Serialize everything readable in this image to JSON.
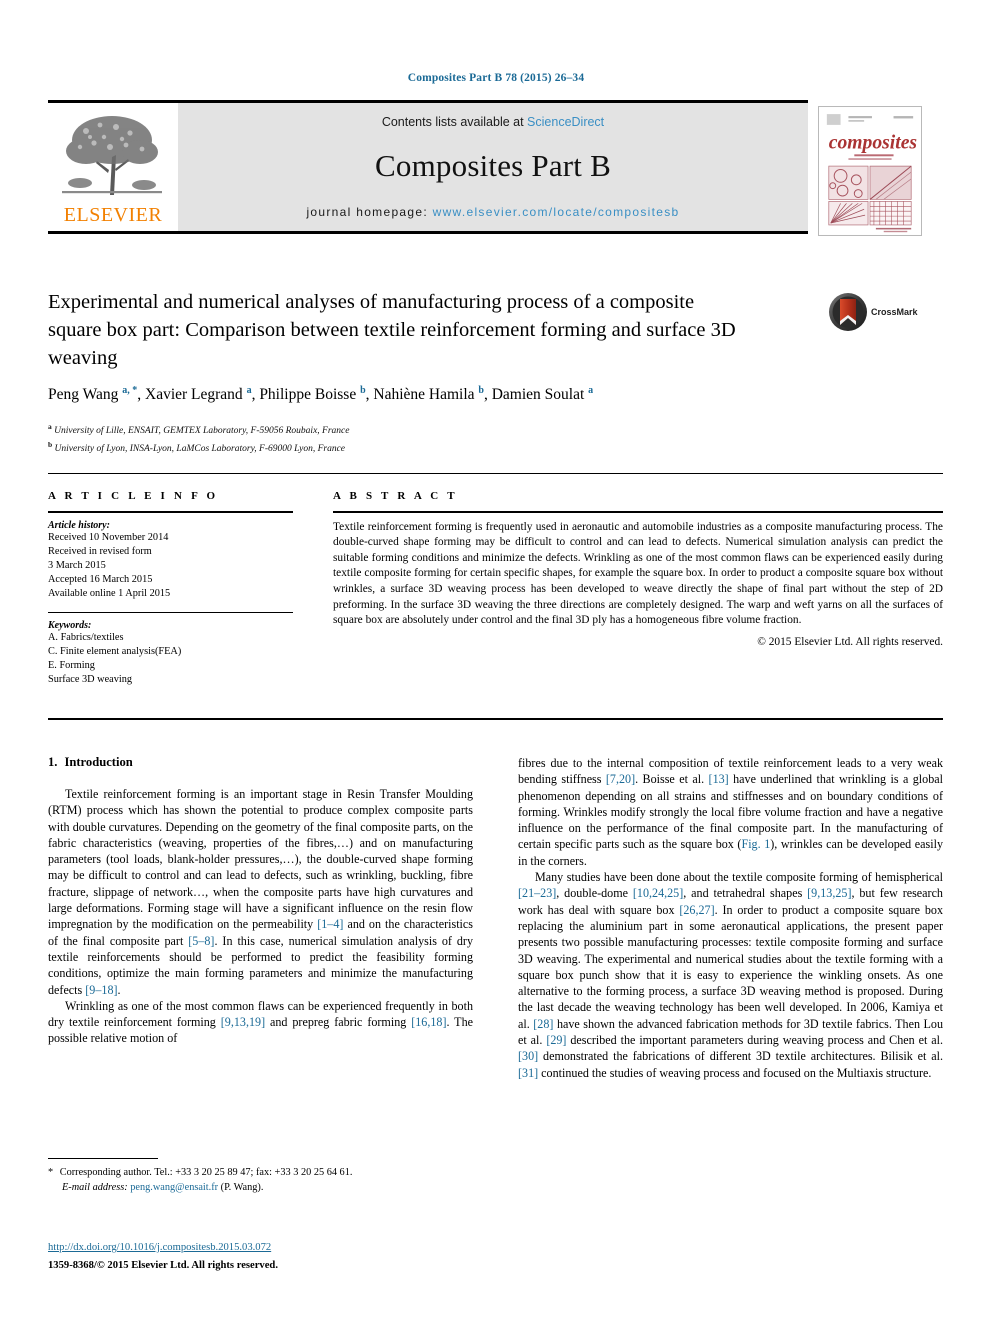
{
  "running_head": "Composites Part B 78 (2015) 26–34",
  "masthead": {
    "contents_prefix": "Contents lists available at ",
    "contents_link": "ScienceDirect",
    "journal_name": "Composites Part B",
    "homepage_prefix": "journal homepage: ",
    "homepage_url": "www.elsevier.com/locate/compositesb",
    "publisher_logo_text": "ELSEVIER",
    "cover_title": "composites",
    "cover_subtitle": "part b: engineering",
    "colors": {
      "link": "#3a8fc4",
      "accent": "#1b6a96",
      "elsevier_orange": "#f28000",
      "masthead_bg": "#e3e3e3"
    }
  },
  "crossmark": {
    "label": "CrossMark"
  },
  "article": {
    "title": "Experimental and numerical analyses of manufacturing process of a composite square box part: Comparison between textile reinforcement forming and surface 3D weaving",
    "authors_html": "Peng Wang <sup>a, *</sup>, Xavier Legrand <sup>a</sup>, Philippe Boisse <sup>b</sup>, Nahiène Hamila <sup>b</sup>, Damien Soulat <sup>a</sup>",
    "affiliations": [
      {
        "marker": "a",
        "text": "University of Lille, ENSAIT, GEMTEX Laboratory, F-59056 Roubaix, France"
      },
      {
        "marker": "b",
        "text": "University of Lyon, INSA-Lyon, LaMCos Laboratory, F-69000 Lyon, France"
      }
    ]
  },
  "article_info": {
    "heading": "A R T I C L E  I N F O",
    "history_label": "Article history:",
    "history": [
      "Received 10 November 2014",
      "Received in revised form",
      "3 March 2015",
      "Accepted 16 March 2015",
      "Available online 1 April 2015"
    ],
    "keywords_label": "Keywords:",
    "keywords": [
      "A. Fabrics/textiles",
      "C. Finite element analysis(FEA)",
      "E. Forming",
      "Surface 3D weaving"
    ]
  },
  "abstract": {
    "heading": "A B S T R A C T",
    "text": "Textile reinforcement forming is frequently used in aeronautic and automobile industries as a composite manufacturing process. The double-curved shape forming may be difficult to control and can lead to defects. Numerical simulation analysis can predict the suitable forming conditions and minimize the defects. Wrinkling as one of the most common flaws can be experienced easily during textile composite forming for certain specific shapes, for example the square box. In order to product a composite square box without wrinkles, a surface 3D weaving process has been developed to weave directly the shape of final part without the step of 2D preforming. In the surface 3D weaving the three directions are completely designed. The warp and weft yarns on all the surfaces of square box are absolutely under control and the final 3D ply has a homogeneous fibre volume fraction.",
    "copyright": "© 2015 Elsevier Ltd. All rights reserved."
  },
  "body": {
    "section_number": "1.",
    "section_title": "Introduction",
    "left_paragraphs_html": [
      "Textile reinforcement forming is an important stage in Resin Transfer Moulding (RTM) process which has shown the potential to produce complex composite parts with double curvatures. Depending on the geometry of the final composite parts, on the fabric characteristics (weaving, properties of the fibres,…) and on manufacturing parameters (tool loads, blank-holder pressures,…), the double-curved shape forming may be difficult to control and can lead to defects, such as wrinkling, buckling, fibre fracture, slippage of network…, when the composite parts have high curvatures and large deformations. Forming stage will have a significant influence on the resin flow impregnation by the modification on the permeability <span class=\"ref\">[1–4]</span> and on the characteristics of the final composite part <span class=\"ref\">[5–8]</span>. In this case, numerical simulation analysis of dry textile reinforcements should be performed to predict the feasibility forming conditions, optimize the main forming parameters and minimize the manufacturing defects <span class=\"ref\">[9–18]</span>.",
      "Wrinkling as one of the most common flaws can be experienced frequently in both dry textile reinforcement forming <span class=\"ref\">[9,13,19]</span> and prepreg fabric forming <span class=\"ref\">[16,18]</span>. The possible relative motion of"
    ],
    "right_paragraphs_html": [
      "fibres due to the internal composition of textile reinforcement leads to a very weak bending stiffness <span class=\"ref\">[7,20]</span>. Boisse et al. <span class=\"ref\">[13]</span> have underlined that wrinkling is a global phenomenon depending on all strains and stiffnesses and on boundary conditions of forming. Wrinkles modify strongly the local fibre volume fraction and have a negative influence on the performance of the final composite part. In the manufacturing of certain specific parts such as the square box (<span class=\"ref\">Fig. 1</span>), wrinkles can be developed easily in the corners.",
      "Many studies have been done about the textile composite forming of hemispherical <span class=\"ref\">[21–23]</span>, double-dome <span class=\"ref\">[10,24,25]</span>, and tetrahedral shapes <span class=\"ref\">[9,13,25]</span>, but few research work has deal with square box <span class=\"ref\">[26,27]</span>. In order to product a composite square box replacing the aluminium part in some aeronautical applications, the present paper presents two possible manufacturing processes: textile composite forming and surface 3D weaving. The experimental and numerical studies about the textile forming with a square box punch show that it is easy to experience the winkling onsets. As one alternative to the forming process, a surface 3D weaving method is proposed. During the last decade the weaving technology has been well developed. In 2006, Kamiya et al. <span class=\"ref\">[28]</span> have shown the advanced fabrication methods for 3D textile fabrics. Then Lou et al. <span class=\"ref\">[29]</span> described the important parameters during weaving process and Chen et al. <span class=\"ref\">[30]</span> demonstrated the fabrications of different 3D textile architectures. Bilisik et al. <span class=\"ref\">[31]</span> continued the studies of weaving process and focused on the Multiaxis structure."
    ]
  },
  "footer": {
    "footnote_html": "<span class=\"star\">*</span> Corresponding author. Tel.: +33 3 20 25 89 47; fax: +33 3 20 25 64 61.<span class=\"ind\"><span class=\"ital\">E-mail address:</span> <span class=\"mail\">peng.wang@ensait.fr</span> (P. Wang).</span>",
    "doi": "http://dx.doi.org/10.1016/j.compositesb.2015.03.072",
    "issn_line": "1359-8368/© 2015 Elsevier Ltd. All rights reserved."
  }
}
